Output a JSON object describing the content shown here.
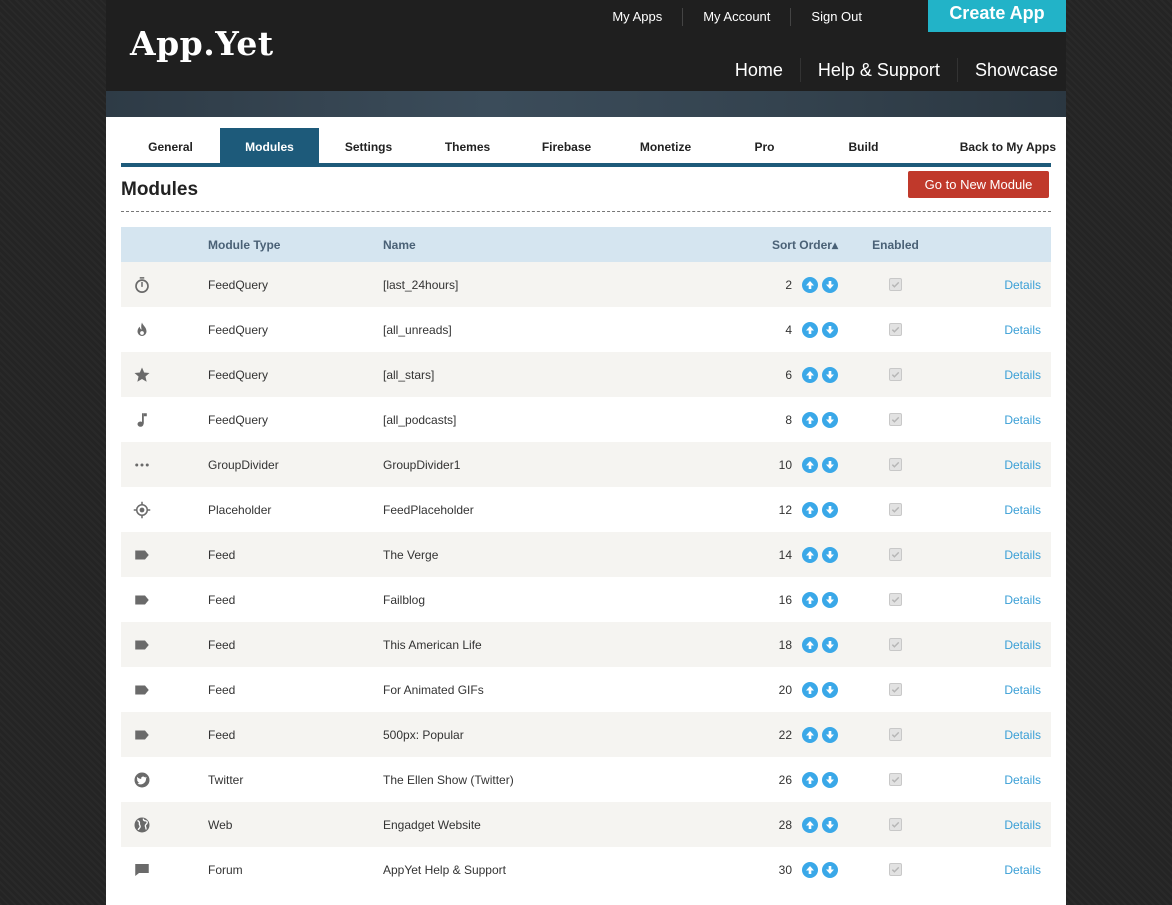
{
  "header": {
    "logo": "App.Yet",
    "toplinks": [
      "My Apps",
      "My Account",
      "Sign Out"
    ],
    "create_button": "Create App",
    "mainnav": [
      "Home",
      "Help & Support",
      "Showcase"
    ]
  },
  "tabs": [
    "General",
    "Modules",
    "Settings",
    "Themes",
    "Firebase",
    "Monetize",
    "Pro",
    "Build",
    "Back to My Apps"
  ],
  "active_tab": "Modules",
  "page": {
    "title": "Modules",
    "new_module_button": "Go to New Module"
  },
  "table": {
    "headers": {
      "type": "Module Type",
      "name": "Name",
      "sort": "Sort Order▴",
      "enabled": "Enabled"
    },
    "rows": [
      {
        "icon": "timer-icon",
        "type": "FeedQuery",
        "name": "[last_24hours]",
        "sort": "2",
        "enabled": true,
        "details": "Details"
      },
      {
        "icon": "flame-icon",
        "type": "FeedQuery",
        "name": "[all_unreads]",
        "sort": "4",
        "enabled": true,
        "details": "Details"
      },
      {
        "icon": "star-icon",
        "type": "FeedQuery",
        "name": "[all_stars]",
        "sort": "6",
        "enabled": true,
        "details": "Details"
      },
      {
        "icon": "music-note-icon",
        "type": "FeedQuery",
        "name": "[all_podcasts]",
        "sort": "8",
        "enabled": true,
        "details": "Details"
      },
      {
        "icon": "dots-icon",
        "type": "GroupDivider",
        "name": "GroupDivider1",
        "sort": "10",
        "enabled": true,
        "details": "Details"
      },
      {
        "icon": "crosshair-icon",
        "type": "Placeholder",
        "name": "FeedPlaceholder",
        "sort": "12",
        "enabled": true,
        "details": "Details"
      },
      {
        "icon": "tag-icon",
        "type": "Feed",
        "name": "The Verge",
        "sort": "14",
        "enabled": true,
        "details": "Details"
      },
      {
        "icon": "tag-icon",
        "type": "Feed",
        "name": "Failblog",
        "sort": "16",
        "enabled": true,
        "details": "Details"
      },
      {
        "icon": "tag-icon",
        "type": "Feed",
        "name": "This American Life",
        "sort": "18",
        "enabled": true,
        "details": "Details"
      },
      {
        "icon": "tag-icon",
        "type": "Feed",
        "name": "For Animated GIFs",
        "sort": "20",
        "enabled": true,
        "details": "Details"
      },
      {
        "icon": "tag-icon",
        "type": "Feed",
        "name": "500px: Popular",
        "sort": "22",
        "enabled": true,
        "details": "Details"
      },
      {
        "icon": "twitter-icon",
        "type": "Twitter",
        "name": "The Ellen Show (Twitter)",
        "sort": "26",
        "enabled": true,
        "details": "Details"
      },
      {
        "icon": "globe-icon",
        "type": "Web",
        "name": "Engadget Website",
        "sort": "28",
        "enabled": true,
        "details": "Details"
      },
      {
        "icon": "chat-bubble-icon",
        "type": "Forum",
        "name": "AppYet Help & Support",
        "sort": "30",
        "enabled": true,
        "details": "Details"
      }
    ]
  },
  "colors": {
    "accent": "#1d5a7a",
    "create_button": "#22b3c8",
    "new_module_button": "#c0392b",
    "link": "#3a9fd6",
    "sort_arrow": "#3aa8e8"
  }
}
